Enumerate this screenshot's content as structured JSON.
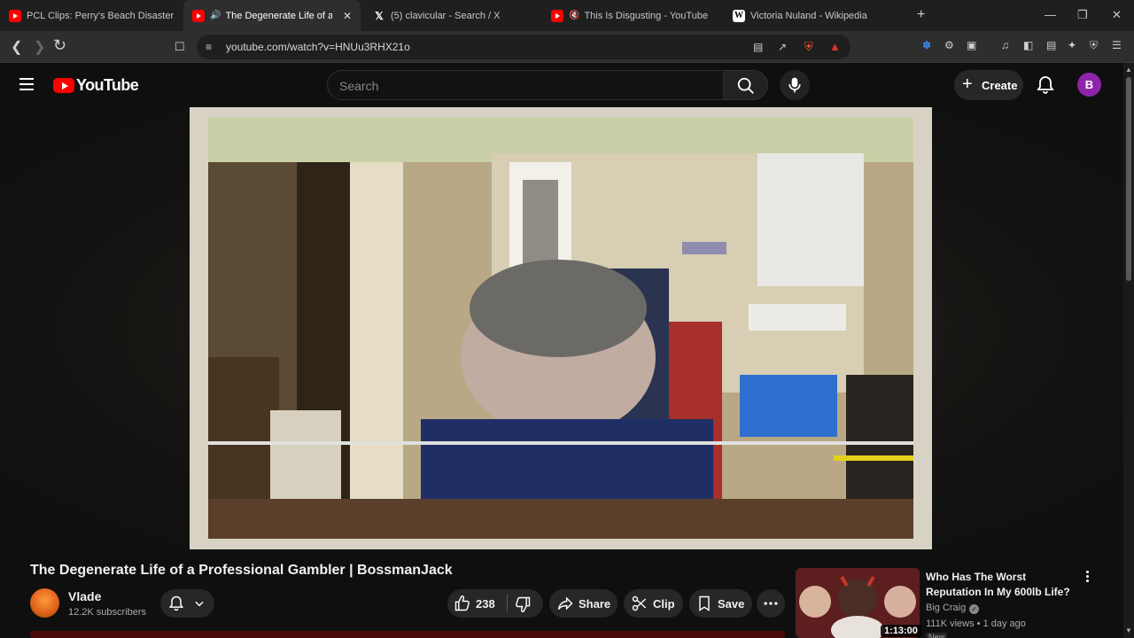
{
  "browser": {
    "tabs": [
      {
        "title": "PCL Clips: Perry's Beach Disaster - Yo",
        "favicon": "youtube-icon",
        "active": false
      },
      {
        "title": "The Degenerate Life of a Prof",
        "favicon": "youtube-icon",
        "active": true,
        "audio": true
      },
      {
        "title": "(5) clavicular - Search / X",
        "favicon": "x-icon",
        "active": false
      },
      {
        "title": "This Is Disgusting - YouTube",
        "favicon": "youtube-icon",
        "active": false,
        "muted": true
      },
      {
        "title": "Victoria Nuland - Wikipedia",
        "favicon": "wikipedia-icon",
        "active": false
      }
    ],
    "url": "youtube.com/watch?v=HNUu3RHX21o"
  },
  "masthead": {
    "logo_text": "YouTube",
    "search_placeholder": "Search",
    "create_label": "Create",
    "avatar_letter": "B"
  },
  "video": {
    "title": "The Degenerate Life of a Professional Gambler | BossmanJack",
    "channel_name": "Vlade",
    "subscribers": "12.2K subscribers",
    "likes": "238",
    "share_label": "Share",
    "clip_label": "Clip",
    "save_label": "Save"
  },
  "recommendation": {
    "title": "Who Has The Worst Reputation In My 600lb Life?",
    "channel": "Big Craig",
    "meta": "111K views • 1 day ago",
    "duration": "1:13:00",
    "badge": "New"
  },
  "colors": {
    "youtube_red": "#ff0000",
    "background": "#0f0f0f",
    "pill": "#272727",
    "avatar": "#8e24aa"
  }
}
